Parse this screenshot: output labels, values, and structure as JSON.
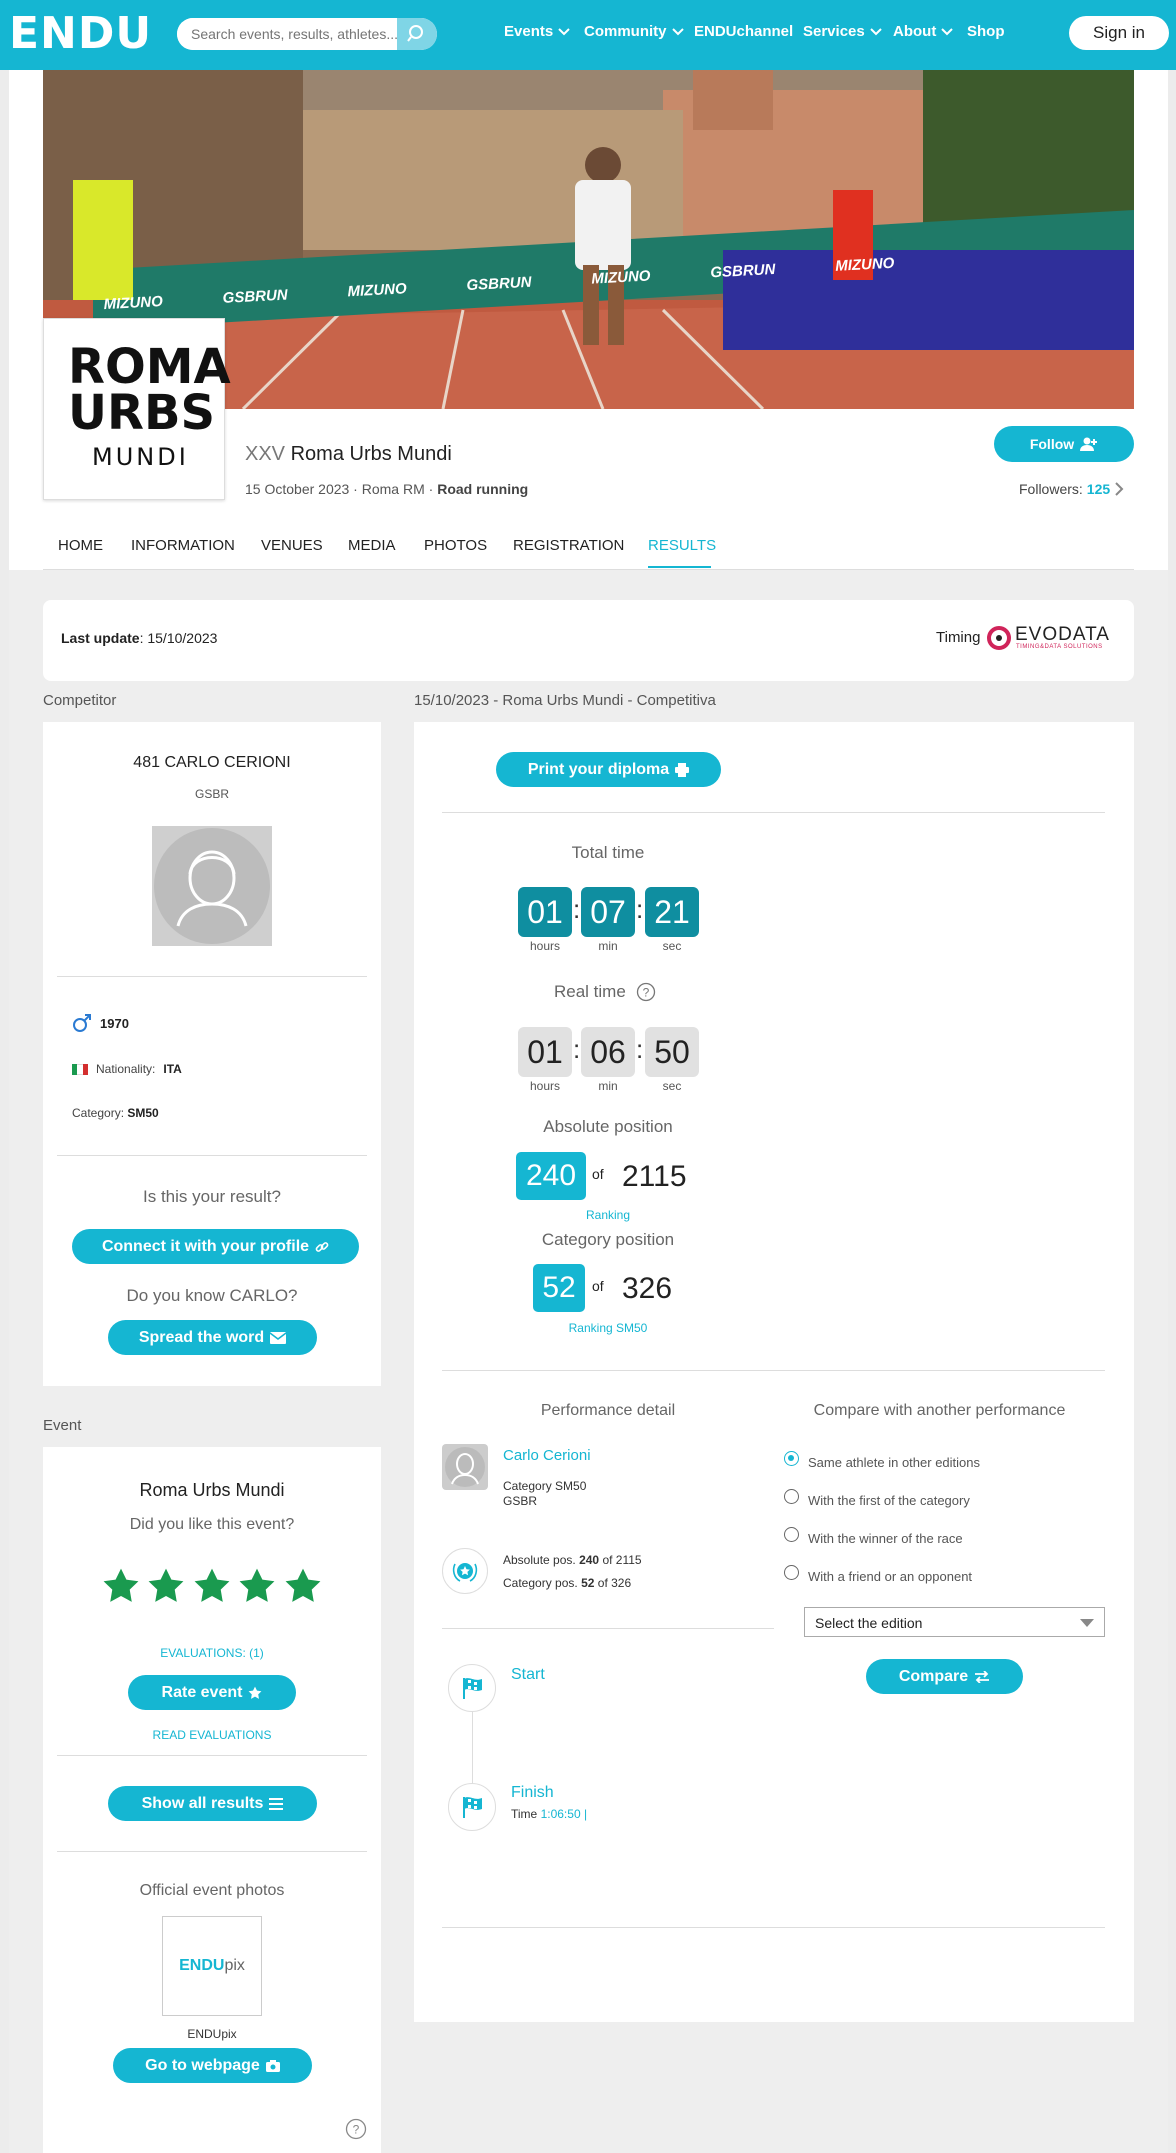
{
  "header": {
    "logo": "ENDU",
    "search_placeholder": "Search events, results, athletes...",
    "nav": [
      "Events",
      "Community",
      "ENDUchannel",
      "Services",
      "About",
      "Shop"
    ],
    "sign_in": "Sign in"
  },
  "event": {
    "logo_lines": [
      "ROMA",
      "URBS",
      "MUNDI"
    ],
    "edition": "XXV",
    "name": "Roma Urbs Mundi",
    "date": "15 October 2023",
    "place": "Roma RM",
    "type": "Road running",
    "follow": "Follow",
    "followers_label": "Followers:",
    "followers_count": "125",
    "banner_text": [
      "MIZUNO",
      "GSBRUN",
      "MIZUNO",
      "GSBRUN",
      "MIZUNO",
      "GSBRUN",
      "MIZUNO"
    ]
  },
  "tabs": [
    "HOME",
    "INFORMATION",
    "VENUES",
    "MEDIA",
    "PHOTOS",
    "REGISTRATION",
    "RESULTS"
  ],
  "update": {
    "label": "Last update",
    "date": "15/10/2023",
    "timing": "Timing",
    "timing_brand": "EVODATA",
    "timing_sub": "TIMING&DATA SOLUTIONS"
  },
  "competitor": {
    "section": "Competitor",
    "bib_name": "481 CARLO CERIONI",
    "team": "GSBR",
    "birth_year": "1970",
    "nationality_label": "Nationality:",
    "nationality": "ITA",
    "category_label": "Category:",
    "category": "SM50",
    "is_your_result": "Is this your result?",
    "connect": "Connect it with your profile",
    "know": "Do you know CARLO?",
    "spread": "Spread the word"
  },
  "result": {
    "heading": "15/10/2023 - Roma Urbs Mundi - Competitiva",
    "print": "Print your diploma",
    "total_time_label": "Total time",
    "total": {
      "h": "01",
      "m": "07",
      "s": "21"
    },
    "real_time_label": "Real time",
    "real": {
      "h": "01",
      "m": "06",
      "s": "50"
    },
    "units": {
      "h": "hours",
      "m": "min",
      "s": "sec"
    },
    "abs_label": "Absolute position",
    "abs_pos": "240",
    "abs_of": "of",
    "abs_total": "2115",
    "ranking": "Ranking",
    "cat_label": "Category position",
    "cat_pos": "52",
    "cat_of": "of",
    "cat_total": "326",
    "ranking_cat": "Ranking SM50"
  },
  "performance": {
    "title": "Performance detail",
    "athlete": "Carlo Cerioni",
    "category_line": "Category SM50",
    "team": "GSBR",
    "abs_prefix": "Absolute pos.",
    "abs_pos": "240",
    "abs_rest": "of 2115",
    "cat_prefix": "Category pos.",
    "cat_pos": "52",
    "cat_rest": "of 326",
    "start": "Start",
    "finish": "Finish",
    "time_label": "Time",
    "time_value": "1:06:50 |"
  },
  "compare": {
    "title": "Compare with another performance",
    "options": [
      "Same athlete in other editions",
      "With the first of the category",
      "With the winner of the race",
      "With a friend or an opponent"
    ],
    "selected": 0,
    "select_value": "Select the edition",
    "button": "Compare"
  },
  "event_box": {
    "section": "Event",
    "name": "Roma Urbs Mundi",
    "question": "Did you like this event?",
    "rating": 5,
    "evaluations": "EVALUATIONS: (1)",
    "rate": "Rate event",
    "read": "READ EVALUATIONS",
    "show_all": "Show all results",
    "photos_title": "Official event photos",
    "pix_brand_a": "ENDU",
    "pix_brand_b": "pix",
    "pix_name": "ENDUpix",
    "webpage": "Go to webpage"
  },
  "colors": {
    "accent": "#15b6d2",
    "teal_dark": "#0f8ea0",
    "star": "#1a9a4f"
  }
}
